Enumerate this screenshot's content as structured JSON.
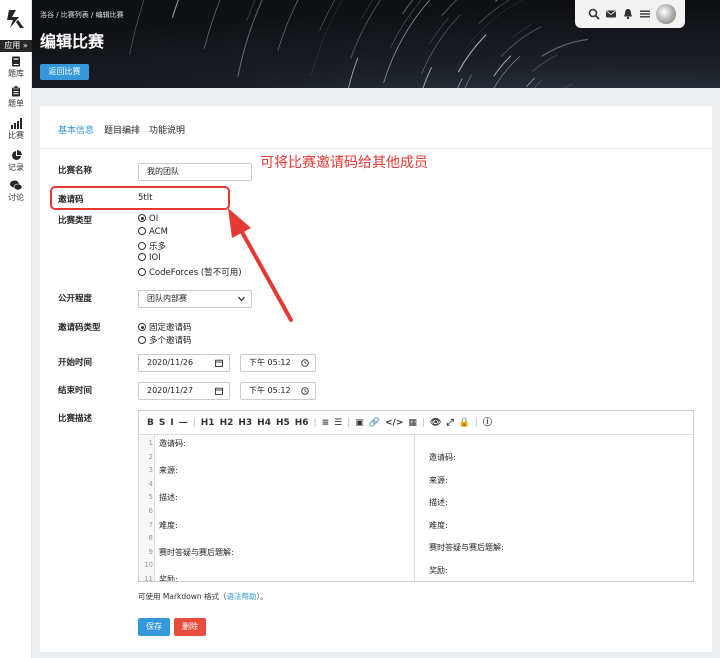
{
  "sidebar": {
    "apps_label": "应用 »",
    "items": [
      {
        "label": "题库",
        "icon": "book-icon"
      },
      {
        "label": "题单",
        "icon": "clipboard-icon"
      },
      {
        "label": "比赛",
        "icon": "bar-chart-icon"
      },
      {
        "label": "记录",
        "icon": "pie-chart-icon"
      },
      {
        "label": "讨论",
        "icon": "chat-icon"
      }
    ]
  },
  "header": {
    "breadcrumb": "洛谷 / 比赛列表 / 编辑比赛",
    "title": "编辑比赛",
    "back_label": "返回比赛",
    "icons": [
      "search-icon",
      "mail-icon",
      "bell-icon",
      "menu-icon"
    ]
  },
  "tabs": [
    "基本信息",
    "题目编排",
    "功能说明"
  ],
  "form": {
    "name_label": "比赛名称",
    "name_value": "我的团队",
    "invite_label": "邀请码",
    "invite_value": "5tlt",
    "type_label": "比赛类型",
    "type_options": [
      "OI",
      "ACM",
      "乐多",
      "IOI",
      "CodeForces (暂不可用)"
    ],
    "type_selected": "OI",
    "visibility_label": "公开程度",
    "visibility_value": "团队内部赛",
    "invite_type_label": "邀请码类型",
    "invite_type_options": [
      "固定邀请码",
      "多个邀请码"
    ],
    "invite_type_selected": "固定邀请码",
    "start_label": "开始时间",
    "start_date": "2020/11/26",
    "start_time": "下午 05:12",
    "end_label": "结束时间",
    "end_date": "2020/11/27",
    "end_time": "下午 05:12",
    "desc_label": "比赛描述"
  },
  "editor": {
    "toolbar": [
      "B",
      "S",
      "I",
      "—",
      "|",
      "H1",
      "H2",
      "H3",
      "H4",
      "H5",
      "H6",
      "|",
      "≡",
      "☰",
      "|",
      "▣",
      "🔗",
      "</>",
      "▦",
      "|",
      "👁",
      "⤢",
      "🔒",
      "|",
      "ⓘ"
    ],
    "line_numbers": [
      "1",
      "2",
      "3",
      "4",
      "5",
      "6",
      "7",
      "8",
      "9",
      "10",
      "11"
    ],
    "source": [
      "邀请码:",
      "",
      "来源:",
      "",
      "描述:",
      "",
      "难度:",
      "",
      "赛时答疑与赛后题解:",
      "",
      "奖励:"
    ],
    "preview": [
      "邀请码:",
      "来源:",
      "描述:",
      "难度:",
      "赛时答疑与赛后题解:",
      "奖励:"
    ]
  },
  "markdown_hint": {
    "prefix": "可使用 Markdown 格式（",
    "link": "语法帮助",
    "suffix": "）。"
  },
  "actions": {
    "save_label": "保存",
    "delete_label": "删除"
  },
  "annotation": {
    "text": "可将比赛邀请码给其他成员"
  },
  "colors": {
    "primary": "#3498db",
    "danger": "#e74c3c",
    "annotation": "#e53935"
  }
}
